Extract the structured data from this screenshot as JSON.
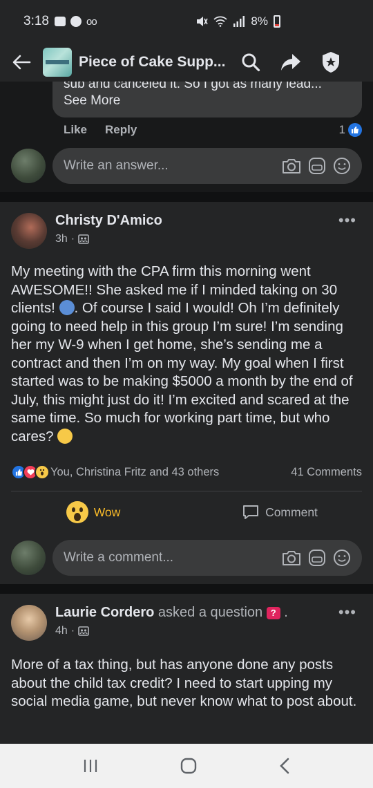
{
  "status_bar": {
    "time": "3:18",
    "battery": "8%",
    "voicemail": "oo"
  },
  "header": {
    "title": "Piece of Cake Supp..."
  },
  "top_comment": {
    "cut_text": "sub and canceled it. So I got as many lead...",
    "see_more": "See More",
    "like_label": "Like",
    "reply_label": "Reply",
    "like_count": "1"
  },
  "answer_input": {
    "placeholder": "Write an answer..."
  },
  "post1": {
    "author": "Christy D'Amico",
    "time": "3h",
    "separator": "·",
    "body_part1": "My meeting with the CPA firm this morning went AWESOME!! She asked me if I minded taking on 30 clients! ",
    "body_part2": ". Of course I said I would! Oh I’m definitely going to need help in this group I’m sure! I’m sending her my W-9 when I get home, she’s sending me a contract and then I’m on my way. My goal when I first started was to be making $5000 a month by the end of July, this might just do it! I’m excited and scared at the same time. So much for working part time, but who cares? ",
    "reactions_text": "You, Christina Fritz and 43 others",
    "comments_count": "41 Comments",
    "wow_label": "Wow",
    "comment_label": "Comment",
    "comment_placeholder": "Write a comment..."
  },
  "post2": {
    "author": "Laurie Cordero",
    "action": "asked a question",
    "action_end": ".",
    "time": "4h",
    "separator": "·",
    "body": "More of a tax thing, but has anyone done any posts about the child tax credit? I need to start upping my social media game, but never know what to post about."
  },
  "colors": {
    "background": "#18191a",
    "card": "#242526",
    "input": "#3a3b3c",
    "accent": "#2374e1",
    "wow": "#f7b928"
  },
  "icons": [
    "back-arrow-icon",
    "search-icon",
    "share-icon",
    "shield-star-icon",
    "camera-icon",
    "gif-icon",
    "emoji-icon",
    "privacy-members-icon",
    "more-icon",
    "comment-icon",
    "recent-apps-icon",
    "home-icon",
    "back-icon"
  ]
}
